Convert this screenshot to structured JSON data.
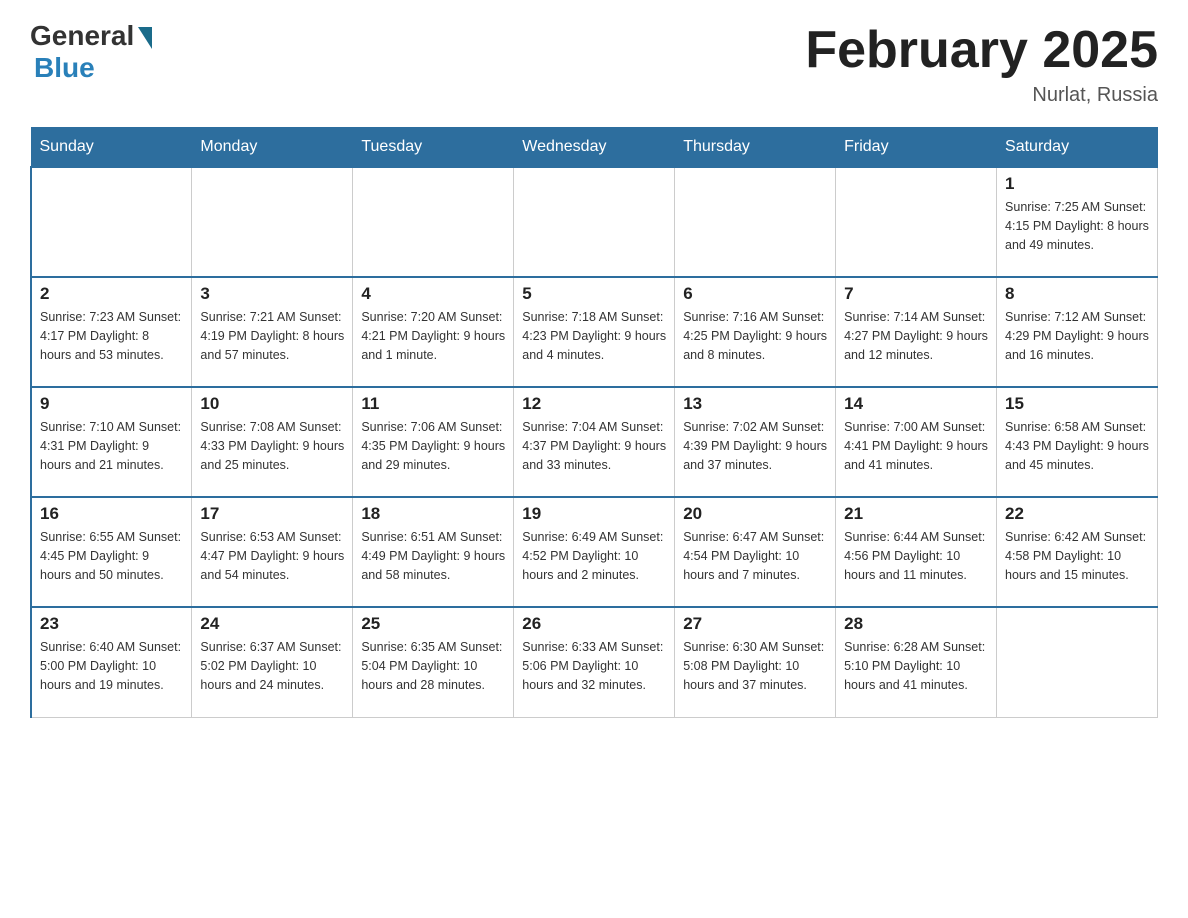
{
  "header": {
    "logo_general": "General",
    "logo_blue": "Blue",
    "month_title": "February 2025",
    "location": "Nurlat, Russia"
  },
  "days_of_week": [
    "Sunday",
    "Monday",
    "Tuesday",
    "Wednesday",
    "Thursday",
    "Friday",
    "Saturday"
  ],
  "weeks": [
    [
      {
        "day": "",
        "info": ""
      },
      {
        "day": "",
        "info": ""
      },
      {
        "day": "",
        "info": ""
      },
      {
        "day": "",
        "info": ""
      },
      {
        "day": "",
        "info": ""
      },
      {
        "day": "",
        "info": ""
      },
      {
        "day": "1",
        "info": "Sunrise: 7:25 AM\nSunset: 4:15 PM\nDaylight: 8 hours\nand 49 minutes."
      }
    ],
    [
      {
        "day": "2",
        "info": "Sunrise: 7:23 AM\nSunset: 4:17 PM\nDaylight: 8 hours\nand 53 minutes."
      },
      {
        "day": "3",
        "info": "Sunrise: 7:21 AM\nSunset: 4:19 PM\nDaylight: 8 hours\nand 57 minutes."
      },
      {
        "day": "4",
        "info": "Sunrise: 7:20 AM\nSunset: 4:21 PM\nDaylight: 9 hours\nand 1 minute."
      },
      {
        "day": "5",
        "info": "Sunrise: 7:18 AM\nSunset: 4:23 PM\nDaylight: 9 hours\nand 4 minutes."
      },
      {
        "day": "6",
        "info": "Sunrise: 7:16 AM\nSunset: 4:25 PM\nDaylight: 9 hours\nand 8 minutes."
      },
      {
        "day": "7",
        "info": "Sunrise: 7:14 AM\nSunset: 4:27 PM\nDaylight: 9 hours\nand 12 minutes."
      },
      {
        "day": "8",
        "info": "Sunrise: 7:12 AM\nSunset: 4:29 PM\nDaylight: 9 hours\nand 16 minutes."
      }
    ],
    [
      {
        "day": "9",
        "info": "Sunrise: 7:10 AM\nSunset: 4:31 PM\nDaylight: 9 hours\nand 21 minutes."
      },
      {
        "day": "10",
        "info": "Sunrise: 7:08 AM\nSunset: 4:33 PM\nDaylight: 9 hours\nand 25 minutes."
      },
      {
        "day": "11",
        "info": "Sunrise: 7:06 AM\nSunset: 4:35 PM\nDaylight: 9 hours\nand 29 minutes."
      },
      {
        "day": "12",
        "info": "Sunrise: 7:04 AM\nSunset: 4:37 PM\nDaylight: 9 hours\nand 33 minutes."
      },
      {
        "day": "13",
        "info": "Sunrise: 7:02 AM\nSunset: 4:39 PM\nDaylight: 9 hours\nand 37 minutes."
      },
      {
        "day": "14",
        "info": "Sunrise: 7:00 AM\nSunset: 4:41 PM\nDaylight: 9 hours\nand 41 minutes."
      },
      {
        "day": "15",
        "info": "Sunrise: 6:58 AM\nSunset: 4:43 PM\nDaylight: 9 hours\nand 45 minutes."
      }
    ],
    [
      {
        "day": "16",
        "info": "Sunrise: 6:55 AM\nSunset: 4:45 PM\nDaylight: 9 hours\nand 50 minutes."
      },
      {
        "day": "17",
        "info": "Sunrise: 6:53 AM\nSunset: 4:47 PM\nDaylight: 9 hours\nand 54 minutes."
      },
      {
        "day": "18",
        "info": "Sunrise: 6:51 AM\nSunset: 4:49 PM\nDaylight: 9 hours\nand 58 minutes."
      },
      {
        "day": "19",
        "info": "Sunrise: 6:49 AM\nSunset: 4:52 PM\nDaylight: 10 hours\nand 2 minutes."
      },
      {
        "day": "20",
        "info": "Sunrise: 6:47 AM\nSunset: 4:54 PM\nDaylight: 10 hours\nand 7 minutes."
      },
      {
        "day": "21",
        "info": "Sunrise: 6:44 AM\nSunset: 4:56 PM\nDaylight: 10 hours\nand 11 minutes."
      },
      {
        "day": "22",
        "info": "Sunrise: 6:42 AM\nSunset: 4:58 PM\nDaylight: 10 hours\nand 15 minutes."
      }
    ],
    [
      {
        "day": "23",
        "info": "Sunrise: 6:40 AM\nSunset: 5:00 PM\nDaylight: 10 hours\nand 19 minutes."
      },
      {
        "day": "24",
        "info": "Sunrise: 6:37 AM\nSunset: 5:02 PM\nDaylight: 10 hours\nand 24 minutes."
      },
      {
        "day": "25",
        "info": "Sunrise: 6:35 AM\nSunset: 5:04 PM\nDaylight: 10 hours\nand 28 minutes."
      },
      {
        "day": "26",
        "info": "Sunrise: 6:33 AM\nSunset: 5:06 PM\nDaylight: 10 hours\nand 32 minutes."
      },
      {
        "day": "27",
        "info": "Sunrise: 6:30 AM\nSunset: 5:08 PM\nDaylight: 10 hours\nand 37 minutes."
      },
      {
        "day": "28",
        "info": "Sunrise: 6:28 AM\nSunset: 5:10 PM\nDaylight: 10 hours\nand 41 minutes."
      },
      {
        "day": "",
        "info": ""
      }
    ]
  ]
}
